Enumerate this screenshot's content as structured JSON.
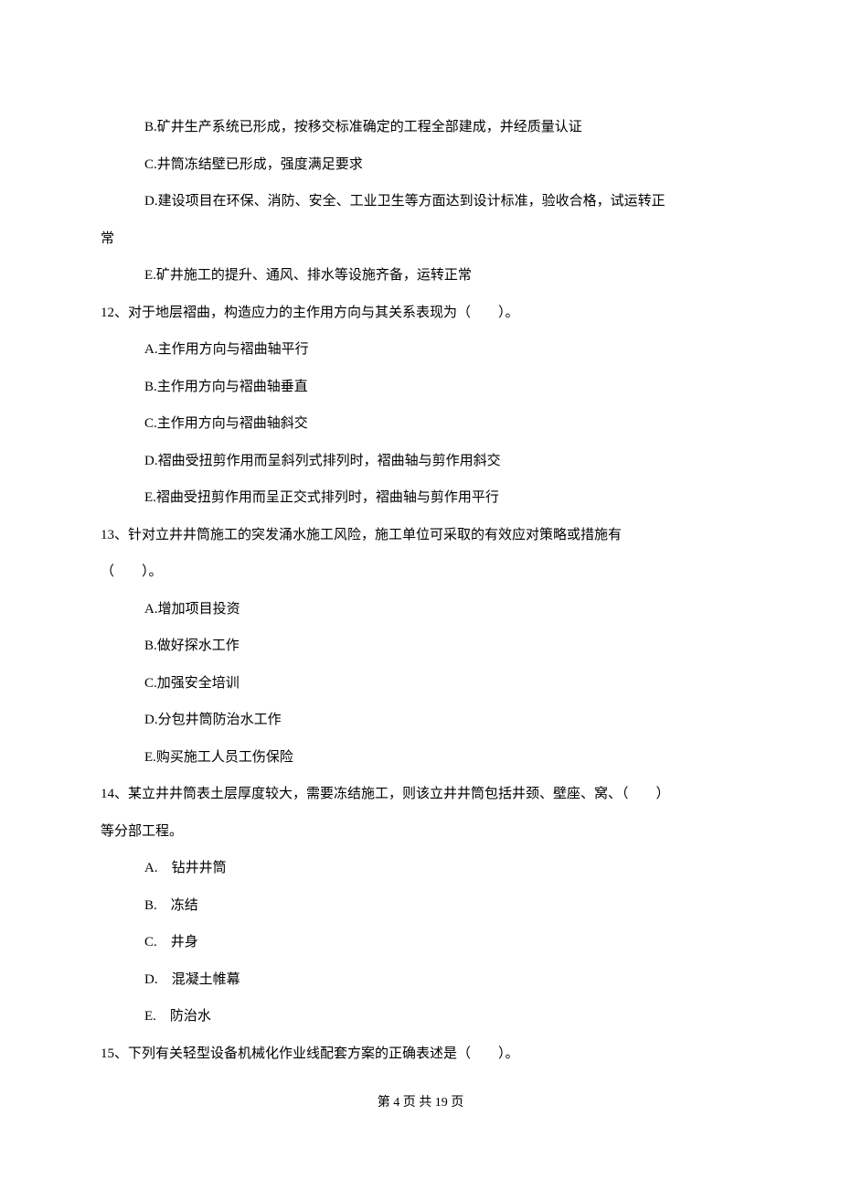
{
  "options_top": {
    "B": "B.矿井生产系统已形成，按移交标准确定的工程全部建成，并经质量认证",
    "C": "C.井筒冻结壁已形成，强度满足要求",
    "D_line1": "D.建设项目在环保、消防、安全、工业卫生等方面达到设计标准，验收合格，试运转正",
    "D_line2": "常",
    "E": "E.矿井施工的提升、通风、排水等设施齐备，运转正常"
  },
  "q12": {
    "stem": "12、对于地层褶曲，构造应力的主作用方向与其关系表现为（　　）。",
    "A": "A.主作用方向与褶曲轴平行",
    "B": "B.主作用方向与褶曲轴垂直",
    "C": "C.主作用方向与褶曲轴斜交",
    "D": "D.褶曲受扭剪作用而呈斜列式排列时，褶曲轴与剪作用斜交",
    "E": "E.褶曲受扭剪作用而呈正交式排列时，褶曲轴与剪作用平行"
  },
  "q13": {
    "stem_line1": "13、针对立井井筒施工的突发涌水施工风险，施工单位可采取的有效应对策略或措施有",
    "stem_line2": "（　　）。",
    "A": "A.增加项目投资",
    "B": "B.做好探水工作",
    "C": "C.加强安全培训",
    "D": "D.分包井筒防治水工作",
    "E": "E.购买施工人员工伤保险"
  },
  "q14": {
    "stem_line1": "14、某立井井筒表土层厚度较大，需要冻结施工，则该立井井筒包括井颈、壁座、窝、（　　）",
    "stem_line2": "等分部工程。",
    "A": "A.　钻井井筒",
    "B": "B.　冻结",
    "C": "C.　井身",
    "D": "D.　混凝土帷幕",
    "E": "E.　防治水"
  },
  "q15": {
    "stem": "15、下列有关轻型设备机械化作业线配套方案的正确表述是（　　）。"
  },
  "footer": "第 4 页 共 19 页"
}
